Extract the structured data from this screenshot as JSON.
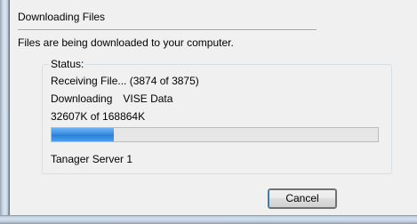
{
  "dialog": {
    "title": "Downloading Files",
    "subtitle": "Files are being downloaded to your computer."
  },
  "status": {
    "legend": "Status:",
    "receiving_line": "Receiving File... (3874 of 3875)",
    "downloading_label": "Downloading",
    "downloading_item": "VISE Data",
    "size_line": "32607K of 168864K",
    "progress_fraction": 0.19,
    "server_name": "Tanager Server 1"
  },
  "buttons": {
    "cancel_label": "Cancel"
  },
  "colors": {
    "progress_fill": "#2b7fd6",
    "button_focus_border": "#3c7fb1"
  }
}
